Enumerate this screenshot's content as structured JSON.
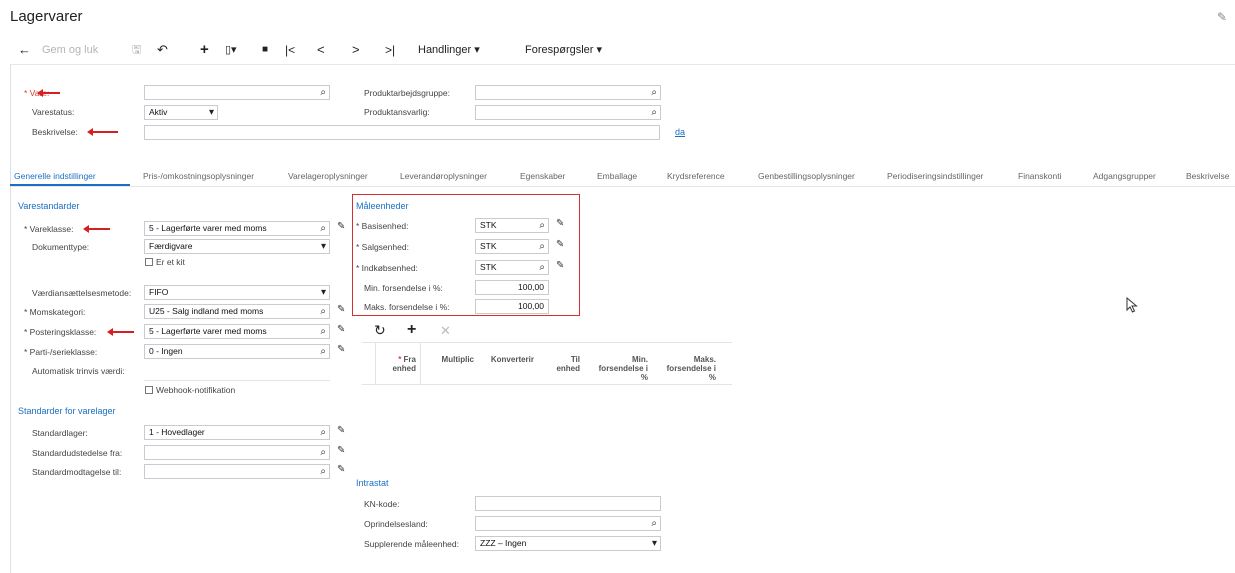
{
  "page": {
    "title": "Lagervarer"
  },
  "toolbar": {
    "back_icon": "←",
    "save_close_label": "Gem og luk",
    "save_icon": "🖫",
    "undo_icon": "↶",
    "add_icon": "+",
    "copy_icon": "▯▾",
    "delete_icon": "■",
    "first_icon": "|<",
    "prev_icon": "<",
    "next_icon": ">",
    "last_icon": ">|",
    "actions_label": "Handlinger ▾",
    "inquiries_label": "Forespørgsler ▾"
  },
  "header": {
    "vare_label": "Vare:",
    "varestatus_label": "Varestatus:",
    "varestatus_value": "Aktiv",
    "beskrivelse_label": "Beskrivelse:",
    "produktarbejdsgruppe_label": "Produktarbejdsgruppe:",
    "produktansvarlig_label": "Produktansvarlig:",
    "language_link": "da"
  },
  "tabs": [
    "Generelle indstillinger",
    "Pris-/omkostningsoplysninger",
    "Varelageroplysninger",
    "Leverandøroplysninger",
    "Egenskaber",
    "Emballage",
    "Krydsreference",
    "Genbestillingsoplysninger",
    "Periodiseringsindstillinger",
    "Finanskonti",
    "Adgangsgrupper",
    "Beskrivelse"
  ],
  "varestandarder": {
    "section": "Varestandarder",
    "vareklasse_label": "Vareklasse:",
    "vareklasse_value": "5 - Lagerførte varer med moms",
    "dokumenttype_label": "Dokumenttype:",
    "dokumenttype_value": "Færdigvare",
    "kit_label": "Er et kit",
    "vaerdi_label": "Værdiansættelsesmetode:",
    "vaerdi_value": "FIFO",
    "moms_label": "Momskategori:",
    "moms_value": "U25 - Salg indland med moms",
    "postering_label": "Posteringsklasse:",
    "postering_value": "5 - Lagerførte varer med moms",
    "parti_label": "Parti-/serieklasse:",
    "parti_value": "0 - Ingen",
    "auto_label": "Automatisk trinvis værdi:",
    "webhook_label": "Webhook-notifikation"
  },
  "lager": {
    "section": "Standarder for varelager",
    "standardlager_label": "Standardlager:",
    "standardlager_value": "1 - Hovedlager",
    "udstedelse_label": "Standardudstedelse fra:",
    "modtagelse_label": "Standardmodtagelse til:"
  },
  "maaleenheder": {
    "section": "Måleenheder",
    "basis_label": "Basisenhed:",
    "basis_value": "STK",
    "salg_label": "Salgsenhed:",
    "salg_value": "STK",
    "indkob_label": "Indkøbsenhed:",
    "indkob_value": "STK",
    "min_label": "Min. forsendelse i %:",
    "min_value": "100,00",
    "maks_label": "Maks. forsendelse i %:",
    "maks_value": "100,00"
  },
  "grid": {
    "refresh_icon": "↻",
    "add_icon": "+",
    "remove_icon": "✕",
    "col_fra": "Fra enhed",
    "col_multi": "Multiplic",
    "col_konv": "Konverterir",
    "col_til": "Til enhed",
    "col_min": "Min. forsendelse i %",
    "col_maks": "Maks. forsendelse i %"
  },
  "intrastat": {
    "section": "Intrastat",
    "kn_label": "KN-kode:",
    "oprindelse_label": "Oprindelsesland:",
    "suppl_label": "Supplerende måleenhed:",
    "suppl_value": "ZZZ – Ingen"
  },
  "colors": {
    "accent": "#1a6fc4",
    "highlight": "#d43030"
  }
}
